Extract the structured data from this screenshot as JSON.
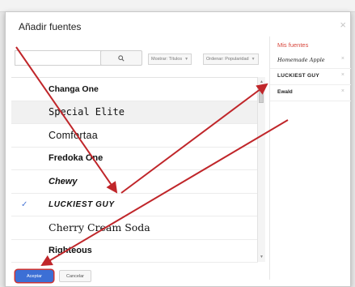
{
  "dialog": {
    "title": "Añadir fuentes",
    "close_glyph": "×"
  },
  "search": {
    "value": "",
    "placeholder": "",
    "icon": "search-icon"
  },
  "filters": {
    "show_label": "Mostrar: Títulos",
    "order_label": "Ordenar: Popularidad"
  },
  "fonts": [
    {
      "name": "Changa One",
      "selected": false
    },
    {
      "name": "Special Elite",
      "selected": false
    },
    {
      "name": "Comfortaa",
      "selected": false
    },
    {
      "name": "Fredoka One",
      "selected": false
    },
    {
      "name": "Chewy",
      "selected": false
    },
    {
      "name": "LUCKIEST GUY",
      "selected": true,
      "check": "✓"
    },
    {
      "name": "Cherry Cream Soda",
      "selected": false
    },
    {
      "name": "Righteous",
      "selected": false
    }
  ],
  "my_fonts": {
    "title": "Mis fuentes",
    "items": [
      {
        "name": "Homemade Apple",
        "remove": "×"
      },
      {
        "name": "LUCKIEST GUY",
        "remove": "×"
      },
      {
        "name": "Ewald",
        "remove": "×"
      }
    ]
  },
  "buttons": {
    "accept": "Aceptar",
    "cancel": "Cancelar"
  },
  "colors": {
    "accent_blue": "#3c6fd5",
    "panel_title_red": "#d8473d",
    "annotation_red": "#c0262a"
  }
}
